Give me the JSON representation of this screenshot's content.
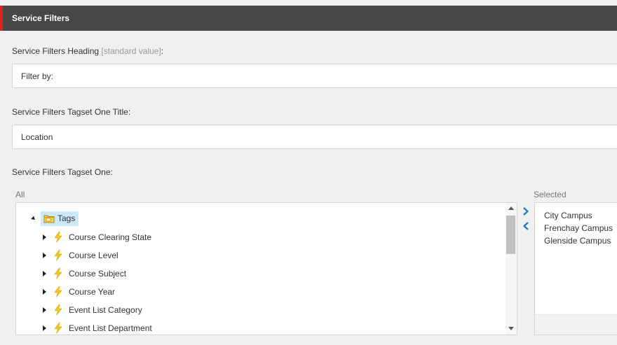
{
  "section": {
    "title": "Service Filters"
  },
  "fields": {
    "heading": {
      "label": "Service Filters Heading",
      "std": "[standard value]",
      "suffix": ":",
      "value": "Filter by:"
    },
    "tagset_title": {
      "label": "Service Filters Tagset One Title:",
      "value": "Location"
    },
    "tagset": {
      "label": "Service Filters Tagset One:"
    }
  },
  "tree": {
    "caption": "All",
    "root": {
      "label": "Tags"
    },
    "items": [
      {
        "label": "Course Clearing State"
      },
      {
        "label": "Course Level"
      },
      {
        "label": "Course Subject"
      },
      {
        "label": "Course Year"
      },
      {
        "label": "Event List Category"
      },
      {
        "label": "Event List Department"
      }
    ]
  },
  "selected": {
    "caption": "Selected",
    "items": [
      "City Campus",
      "Frenchay Campus",
      "Glenside Campus"
    ]
  },
  "colors": {
    "header_bg": "#474747",
    "header_accent": "#d9251c",
    "selection_highlight": "#cde8f7",
    "arrow_blue": "#2b78c2",
    "bolt_yellow": "#f7c61e"
  },
  "icons": {
    "root": "folder-tag-icon",
    "item": "lightning-bolt-icon",
    "add": "chevron-right-icon",
    "remove": "chevron-left-icon"
  }
}
